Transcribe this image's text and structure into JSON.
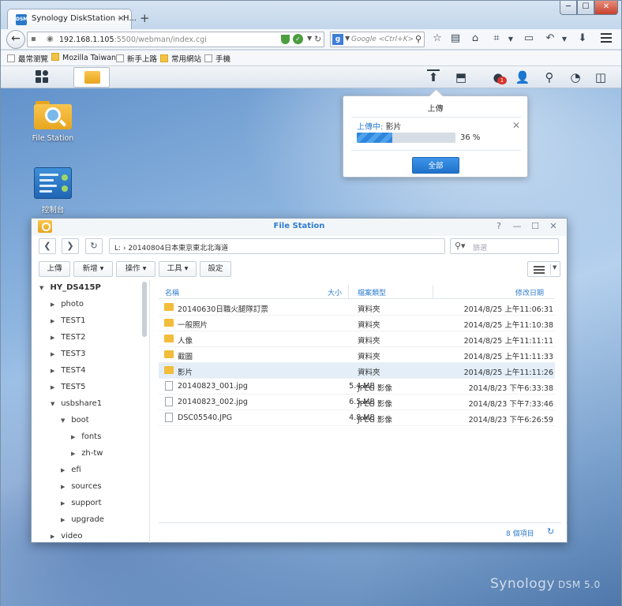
{
  "browser": {
    "tab_title": "Synology DiskStation - H...",
    "favicon_text": "DSM",
    "url_host": "192.168.1.105",
    "url_rest": ":5500/webman/index.cgi",
    "search_placeholder": "Google <Ctrl+K>",
    "search_engine_letter": "g"
  },
  "bookmarks": [
    {
      "label": "最常瀏覽",
      "icon": "page"
    },
    {
      "label": "Mozilla Taiwan",
      "icon": "folder"
    },
    {
      "label": "新手上路",
      "icon": "page"
    },
    {
      "label": "常用網站",
      "icon": "folder"
    },
    {
      "label": "手機",
      "icon": "page"
    }
  ],
  "desktop": {
    "icons": [
      {
        "label": "File Station"
      },
      {
        "label": "控制台"
      }
    ],
    "notification_count": "1",
    "brand": "Synology",
    "brand_version": "DSM 5.0"
  },
  "upload_popup": {
    "title": "上傳",
    "status_prefix": "上傳中:",
    "file_name": "影片",
    "progress_percent": 36,
    "progress_label": "36 %",
    "all_button": "全部"
  },
  "file_station": {
    "title": "File Station",
    "path": "L:  ›  20140804日本東京東北北海道",
    "search_placeholder": "篩選",
    "toolbar": {
      "upload": "上傳",
      "create": "新增",
      "action": "操作",
      "tools": "工具",
      "settings": "設定"
    },
    "tree": [
      {
        "label": "HY_DS415P",
        "arrow": "▼"
      },
      {
        "label": "photo",
        "arrow": "▶"
      },
      {
        "label": "TEST1",
        "arrow": "▶"
      },
      {
        "label": "TEST2",
        "arrow": "▶"
      },
      {
        "label": "TEST3",
        "arrow": "▶"
      },
      {
        "label": "TEST4",
        "arrow": "▶"
      },
      {
        "label": "TEST5",
        "arrow": "▶"
      },
      {
        "label": "usbshare1",
        "arrow": "▼"
      },
      {
        "label": "boot",
        "arrow": "▼"
      },
      {
        "label": "fonts",
        "arrow": "▶"
      },
      {
        "label": "zh-tw",
        "arrow": "▶"
      },
      {
        "label": "efi",
        "arrow": "▶"
      },
      {
        "label": "sources",
        "arrow": "▶"
      },
      {
        "label": "support",
        "arrow": "▶"
      },
      {
        "label": "upgrade",
        "arrow": "▶"
      },
      {
        "label": "video",
        "arrow": "▶"
      }
    ],
    "columns": {
      "name": "名稱",
      "size": "大小",
      "type": "檔案類型",
      "date": "修改日期"
    },
    "files": [
      {
        "name": "20140630日職火腿隊訂票",
        "size": "",
        "type": "資料夾",
        "date": "2014/8/25 上午11:06:31",
        "kind": "folder"
      },
      {
        "name": "一般照片",
        "size": "",
        "type": "資料夾",
        "date": "2014/8/25 上午11:10:38",
        "kind": "folder"
      },
      {
        "name": "人像",
        "size": "",
        "type": "資料夾",
        "date": "2014/8/25 上午11:11:11",
        "kind": "folder"
      },
      {
        "name": "截圖",
        "size": "",
        "type": "資料夾",
        "date": "2014/8/25 上午11:11:33",
        "kind": "folder"
      },
      {
        "name": "影片",
        "size": "",
        "type": "資料夾",
        "date": "2014/8/25 上午11:11:26",
        "kind": "folder"
      },
      {
        "name": "20140823_001.jpg",
        "size": "5.4 MB",
        "type": "JPEG 影像",
        "date": "2014/8/23 下午6:33:38",
        "kind": "file"
      },
      {
        "name": "20140823_002.jpg",
        "size": "6.5 MB",
        "type": "JPEG 影像",
        "date": "2014/8/23 下午7:33:46",
        "kind": "file"
      },
      {
        "name": "DSC05540.JPG",
        "size": "4.8 MB",
        "type": "JPEG 影像",
        "date": "2014/8/23 下午6:26:59",
        "kind": "file"
      }
    ],
    "selected_index": 4,
    "item_count": "8 個項目"
  },
  "colors": {
    "accent": "#2f7ccf",
    "progress": "#2c86dc",
    "folder": "#f2bd3a",
    "badge": "#d8322c"
  }
}
